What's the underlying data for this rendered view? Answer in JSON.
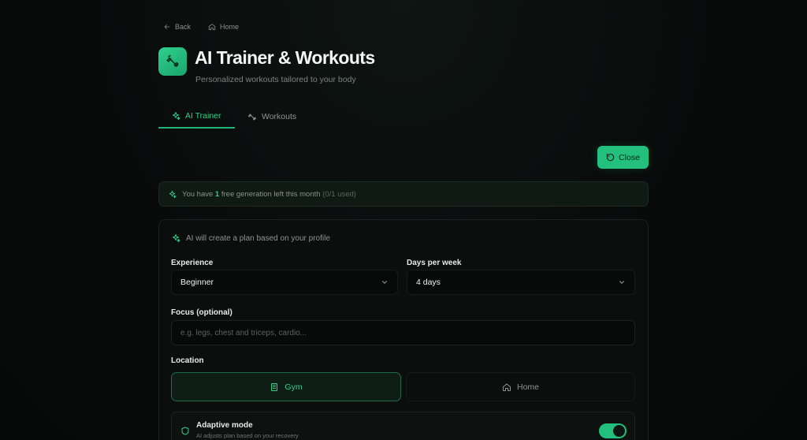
{
  "nav": {
    "back": "Back",
    "home": "Home"
  },
  "header": {
    "title": "AI Trainer & Workouts",
    "subtitle": "Personalized workouts tailored to your body"
  },
  "tabs": [
    {
      "label": "AI Trainer",
      "active": true
    },
    {
      "label": "Workouts",
      "active": false
    }
  ],
  "close_label": "Close",
  "banner": {
    "prefix": "You have",
    "count": "1",
    "suffix": "free generation left this month",
    "used": "(0/1 used)"
  },
  "form": {
    "note": "AI will create a plan based on your profile",
    "experience": {
      "label": "Experience",
      "value": "Beginner"
    },
    "days": {
      "label": "Days per week",
      "value": "4 days"
    },
    "focus": {
      "label": "Focus (optional)",
      "placeholder": "e.g. legs, chest and triceps, cardio..."
    },
    "location": {
      "label": "Location",
      "options": [
        {
          "label": "Gym",
          "selected": true
        },
        {
          "label": "Home",
          "selected": false
        }
      ]
    },
    "adaptive": {
      "title": "Adaptive mode",
      "description": "AI adjusts plan based on your recovery",
      "enabled": true
    }
  },
  "colors": {
    "accent": "#22c07c",
    "accent_text": "#2ed18a",
    "background": "#090b0b",
    "card": "#0c0e0e"
  },
  "icons": {
    "back": "arrow-left-icon",
    "home": "home-icon",
    "app": "dumbbell-icon",
    "ai": "sparkles-icon",
    "close": "refresh-icon",
    "gym": "building-icon",
    "adaptive": "shield-icon",
    "chevron": "chevron-down-icon"
  }
}
